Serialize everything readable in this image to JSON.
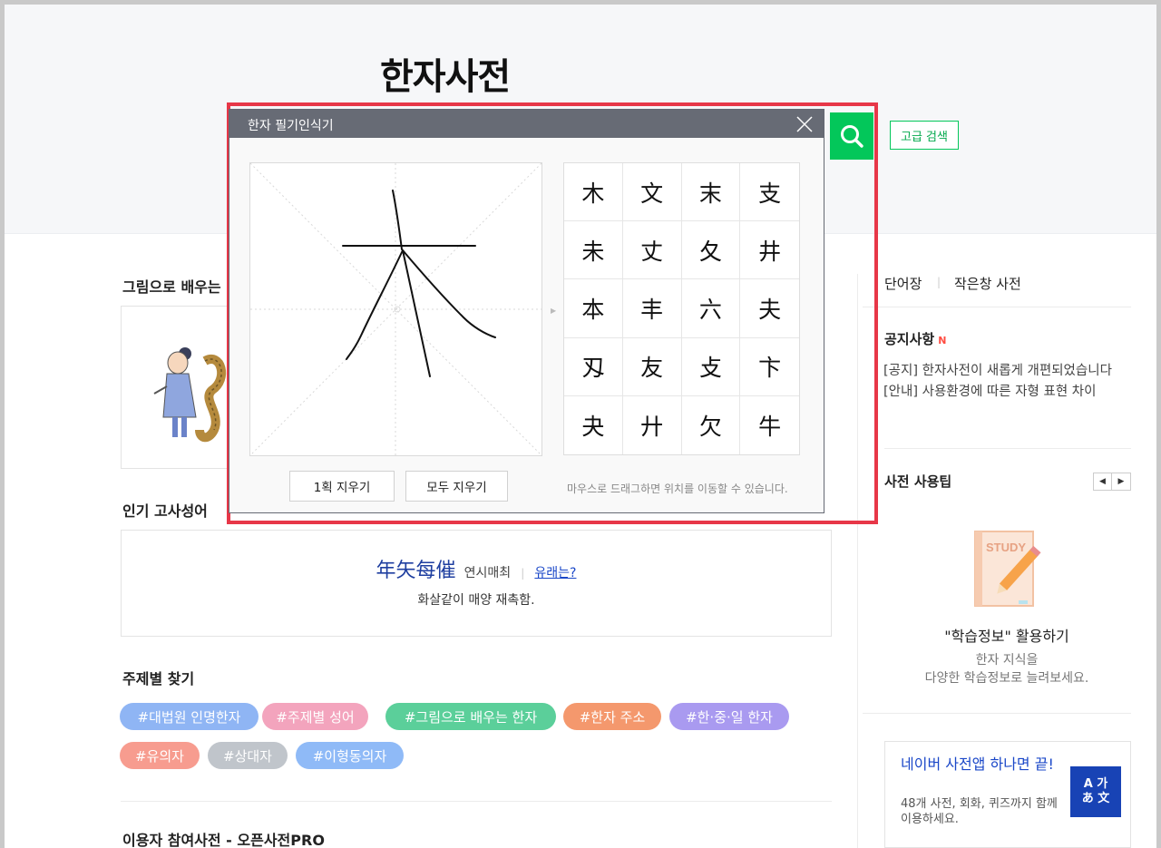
{
  "header": {
    "brand": "한자사전",
    "advanced_search_label": "고급 검색",
    "colors": {
      "naver_green": "#03c75a",
      "popup_outline": "#e73748"
    }
  },
  "sections": {
    "picture_learning": {
      "title": "그림으로 배우는"
    },
    "popular_idioms": {
      "title": "인기 고사성어",
      "hanja": "年矢每催",
      "reading": "연시매최",
      "origin_link": "유래는?",
      "meaning": "화살같이 매양 재촉함."
    },
    "topics": {
      "title": "주제별 찾기",
      "tags": [
        {
          "label": "#대법원 인명한자",
          "color": "#8fb5f4"
        },
        {
          "label": "#주제별 성어",
          "color": "#f3a4bd"
        },
        {
          "label": "#그림으로 배우는 한자",
          "color": "#5bcf9a"
        },
        {
          "label": "#한자 주소",
          "color": "#f4986d"
        },
        {
          "label": "#한·중·일 한자",
          "color": "#a99af0"
        },
        {
          "label": "#유의자",
          "color": "#f79c8f"
        },
        {
          "label": "#상대자",
          "color": "#c0c5cb"
        },
        {
          "label": "#이형동의자",
          "color": "#8fbaf7"
        }
      ]
    },
    "open_dict": {
      "title": "이용자 참여사전 - 오픈사전PRO"
    }
  },
  "right": {
    "links": [
      "단어장",
      "작은창 사전"
    ],
    "notice": {
      "title": "공지사항",
      "new_badge": "N",
      "items": [
        "[공지] 한자사전이 새롭게 개편되었습니다",
        "[안내] 사용환경에 따른 자형 표현 차이"
      ]
    },
    "tips": {
      "title": "사전 사용팁",
      "pager_prev": "◀",
      "pager_next": "▶",
      "illustration_text": "STUDY",
      "heading": "\"학습정보\" 활용하기",
      "desc_line1": "한자 지식을",
      "desc_line2": "다양한 학습정보로 늘려보세요."
    },
    "app": {
      "title": "네이버 사전앱 하나면 끝!",
      "desc": "48개 사전, 회화, 퀴즈까지 함께 이용하세요.",
      "icon_top": "A 가",
      "icon_bottom": "あ 文"
    }
  },
  "popup": {
    "title": "한자 필기인식기",
    "candidates": [
      "木",
      "文",
      "末",
      "支",
      "未",
      "丈",
      "夂",
      "井",
      "本",
      "丰",
      "六",
      "夫",
      "刄",
      "友",
      "攴",
      "卞",
      "夬",
      "廾",
      "欠",
      "牛"
    ],
    "clear_stroke_label": "1획 지우기",
    "clear_all_label": "모두 지우기",
    "hint": "마우스로 드래그하면 위치를 이동할 수 있습니다."
  }
}
